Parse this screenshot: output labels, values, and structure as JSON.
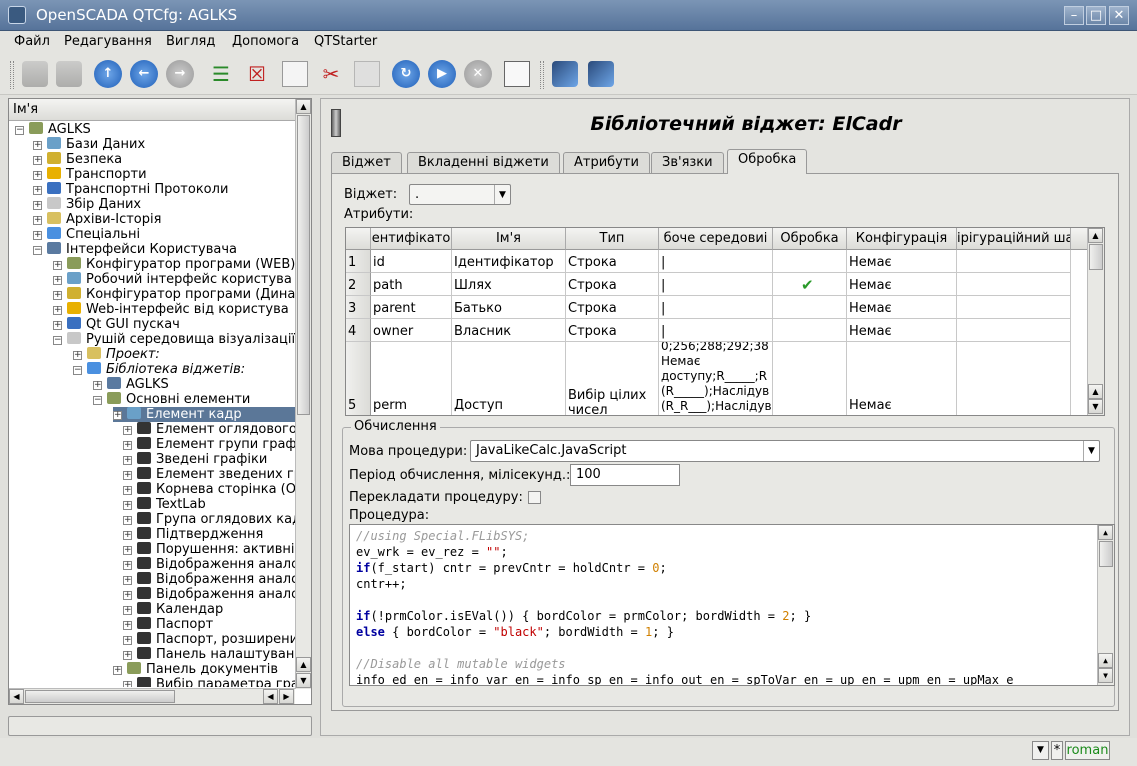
{
  "window": {
    "title": "OpenSCADA QTCfg: AGLKS"
  },
  "menu": [
    "Файл",
    "Редагування",
    "Вигляд",
    "Допомога",
    "QTStarter"
  ],
  "tree": {
    "header": "Ім'я",
    "items": [
      {
        "label": "AGLKS",
        "level": 0
      },
      {
        "label": "Бази Даних",
        "level": 1
      },
      {
        "label": "Безпека",
        "level": 1
      },
      {
        "label": "Транспорти",
        "level": 1
      },
      {
        "label": "Транспортні Протоколи",
        "level": 1
      },
      {
        "label": "Збір Даних",
        "level": 1
      },
      {
        "label": "Архіви-Історія",
        "level": 1
      },
      {
        "label": "Спеціальні",
        "level": 1
      },
      {
        "label": "Інтерфейси Користувача",
        "level": 1
      },
      {
        "label": "Конфігуратор програми (WEB)",
        "level": 2
      },
      {
        "label": "Робочий інтерфейс користува",
        "level": 2
      },
      {
        "label": "Конфігуратор програми (Дина",
        "level": 2
      },
      {
        "label": "Web-інтерфейс від користува",
        "level": 2
      },
      {
        "label": "Qt GUI пускач",
        "level": 2
      },
      {
        "label": "Рушій середовища візуалізації",
        "level": 2
      },
      {
        "label": "Проект:",
        "level": 3
      },
      {
        "label": "Бібліотека віджетів:",
        "level": 3
      },
      {
        "label": "AGLKS",
        "level": 4
      },
      {
        "label": "Основні елементи",
        "level": 4
      },
      {
        "label": "Елемент кадр",
        "level": 5
      },
      {
        "label": "Елемент оглядового",
        "level": 6
      },
      {
        "label": "Елемент групи графі",
        "level": 6
      },
      {
        "label": "Зведені графіки",
        "level": 6
      },
      {
        "label": "Елемент зведених гр",
        "level": 6
      },
      {
        "label": "Корнева сторінка (ОС",
        "level": 6
      },
      {
        "label": "TextLab",
        "level": 6
      },
      {
        "label": "Група оглядових кад",
        "level": 6
      },
      {
        "label": "Підтвердження",
        "level": 6
      },
      {
        "label": "Порушення: активні",
        "level": 6
      },
      {
        "label": "Відображення анало",
        "level": 6
      },
      {
        "label": "Відображення анало",
        "level": 6
      },
      {
        "label": "Відображення анало",
        "level": 6
      },
      {
        "label": "Календар",
        "level": 6
      },
      {
        "label": "Паспорт",
        "level": 6
      },
      {
        "label": "Паспорт, розширений",
        "level": 6
      },
      {
        "label": "Панель налаштуванн",
        "level": 6
      },
      {
        "label": "Панель документів",
        "level": 5
      },
      {
        "label": "Вибір параметра гра",
        "level": 6
      }
    ]
  },
  "page": {
    "title": "Бібліотечний віджет: ElCadr",
    "tabs": [
      "Віджет",
      "Вкладенні віджети",
      "Атрибути",
      "Зв'язки",
      "Обробка"
    ],
    "active_tab": "Обробка",
    "widget_label": "Віджет:",
    "widget_value": ".",
    "attributes_label": "Атрибути:",
    "columns": [
      "ентифікато",
      "Ім'я",
      "Тип",
      "боче середовиі",
      "Обробка",
      "Конфігурація",
      "ірігураційний ша"
    ],
    "rows": [
      {
        "n": "1",
        "id": "id",
        "name": "Ідентифікатор",
        "type": "Строка",
        "work": "|",
        "proc": "",
        "cfg": "Немає",
        "tmpl": ""
      },
      {
        "n": "2",
        "id": "path",
        "name": "Шлях",
        "type": "Строка",
        "work": "|",
        "proc": "✔",
        "cfg": "Немає",
        "tmpl": ""
      },
      {
        "n": "3",
        "id": "parent",
        "name": "Батько",
        "type": "Строка",
        "work": "|",
        "proc": "",
        "cfg": "Немає",
        "tmpl": ""
      },
      {
        "n": "4",
        "id": "owner",
        "name": "Власник",
        "type": "Строка",
        "work": "|",
        "proc": "",
        "cfg": "Немає",
        "tmpl": ""
      },
      {
        "n": "5",
        "id": "perm",
        "name": "Доступ",
        "type": "Вибір цілих чисел",
        "work": "0;256;288;292;38\nНемає\nдоступу;R_____;R\n(R_____);Наслідув\n(R_R___);Наслідув",
        "proc": "",
        "cfg": "Немає",
        "tmpl": ""
      }
    ],
    "calc": {
      "group_title": "Обчислення",
      "lang_label": "Мова процедури:",
      "lang_value": "JavaLikeCalc.JavaScript",
      "period_label": "Період обчислення, мілісекунд.:",
      "period_value": "100",
      "translate_label": "Перекладати процедуру:",
      "procedure_label": "Процедура:",
      "code_lines": [
        "//using Special.FLibSYS;",
        "ev_wrk = ev_rez = \"\";",
        "if(f_start) cntr = prevCntr = holdCntr = 0;",
        "cntr++;",
        "",
        "if(!prmColor.isEVal()) { bordColor = prmColor; bordWidth = 2; }",
        "else { bordColor = \"black\"; bordWidth = 1; }",
        "",
        "//Disable all mutable widgets",
        "info_ed_en = info_var_en = info_sp_en = info_out_en = spToVar_en = up_en = upm_en = upMax_e"
      ]
    }
  },
  "status": {
    "user": "roman",
    "modified": "*"
  }
}
